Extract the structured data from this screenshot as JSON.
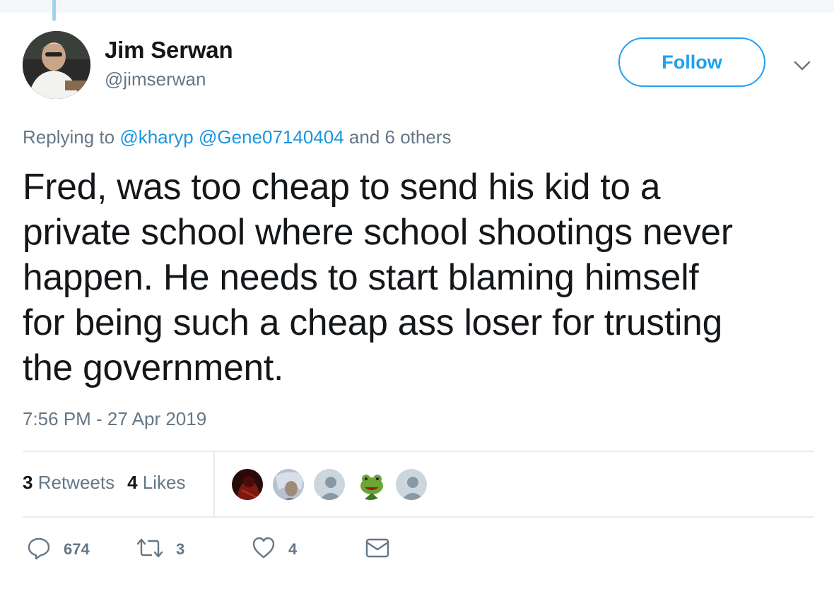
{
  "tweet": {
    "author": {
      "name": "Jim Serwan",
      "handle": "@jimserwan"
    },
    "follow_label": "Follow",
    "reply": {
      "prefix": "Replying to",
      "mention_1": "@kharyp",
      "mention_2": "@Gene07140404",
      "suffix": "and 6 others"
    },
    "text_lines": [
      "Fred, was too cheap to send his kid to a",
      "private school where school shootings never",
      "happen. He needs to start blaming himself",
      "for being such a cheap ass loser for trusting",
      "the government."
    ],
    "timestamp": "7:56 PM - 27 Apr 2019",
    "stats": {
      "retweets_count": "3",
      "retweets_label": "Retweets",
      "likes_count": "4",
      "likes_label": "Likes"
    },
    "actions": {
      "replies": "674",
      "retweets": "3",
      "likes": "4"
    },
    "icons": [
      "chevron-down-icon",
      "reply-icon",
      "retweet-icon",
      "heart-icon",
      "message-icon"
    ],
    "colors": {
      "accent": "#1da1f2",
      "mention": "#1b95e0",
      "muted": "#657786",
      "text": "#14171a",
      "divider": "#e6ecf0"
    }
  }
}
